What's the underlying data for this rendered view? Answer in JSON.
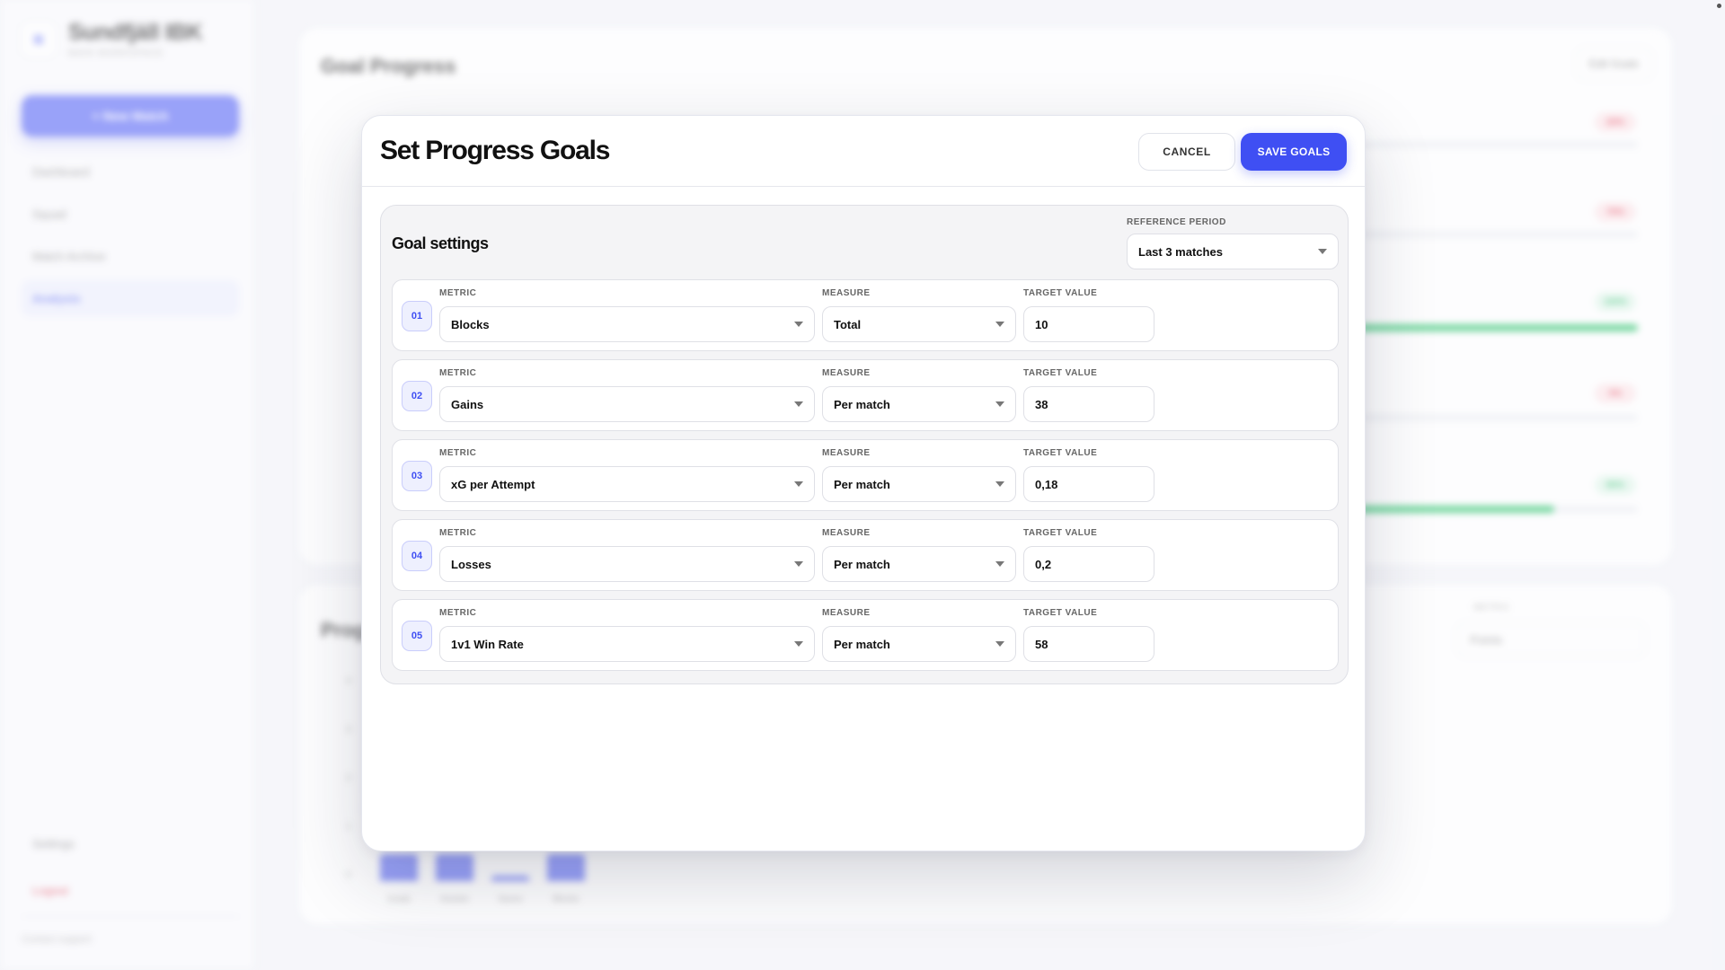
{
  "background": {
    "brand_name": "Sundfjäll IBK",
    "brand_subtitle": "MAIN WORKSPACE",
    "new_match_label": "+ New Match",
    "nav": [
      "Dashboard",
      "Squad",
      "Match Archive",
      "Analysis"
    ],
    "settings_label": "Settings",
    "logout_label": "Logout",
    "support_label": "Contact support",
    "card1_title": "Goal Progress",
    "edit_goals_label": "Edit Goals",
    "goal_pills": [
      "20%",
      "70%",
      "100%",
      "0%",
      "80%"
    ],
    "goal_fills": [
      0,
      0,
      1.0,
      0,
      0.7
    ],
    "card2_title": "Progress",
    "metric_label": "METRIC",
    "metric_value": "Points",
    "y_ticks": [
      "4",
      "3",
      "2",
      "1",
      "0"
    ],
    "bars": [
      {
        "label": "Goals",
        "value": 0.5
      },
      {
        "label": "Assists",
        "value": 0.5
      },
      {
        "label": "Saves",
        "value": 0.1
      },
      {
        "label": "Blocks",
        "value": 0.5
      }
    ]
  },
  "modal": {
    "title": "Set Progress Goals",
    "cancel_label": "CANCEL",
    "save_label": "SAVE GOALS",
    "panel_title": "Goal settings",
    "reference_period_label": "REFERENCE PERIOD",
    "reference_period_value": "Last 3 matches",
    "metric_label": "METRIC",
    "measure_label": "MEASURE",
    "target_label": "TARGET VALUE",
    "goals": [
      {
        "num": "01",
        "metric": "Blocks",
        "measure": "Total",
        "target": "10"
      },
      {
        "num": "02",
        "metric": "Gains",
        "measure": "Per match",
        "target": "38"
      },
      {
        "num": "03",
        "metric": "xG per Attempt",
        "measure": "Per match",
        "target": "0,18"
      },
      {
        "num": "04",
        "metric": "Losses",
        "measure": "Per match",
        "target": "0,2"
      },
      {
        "num": "05",
        "metric": "1v1 Win Rate",
        "measure": "Per match",
        "target": "58"
      }
    ]
  }
}
